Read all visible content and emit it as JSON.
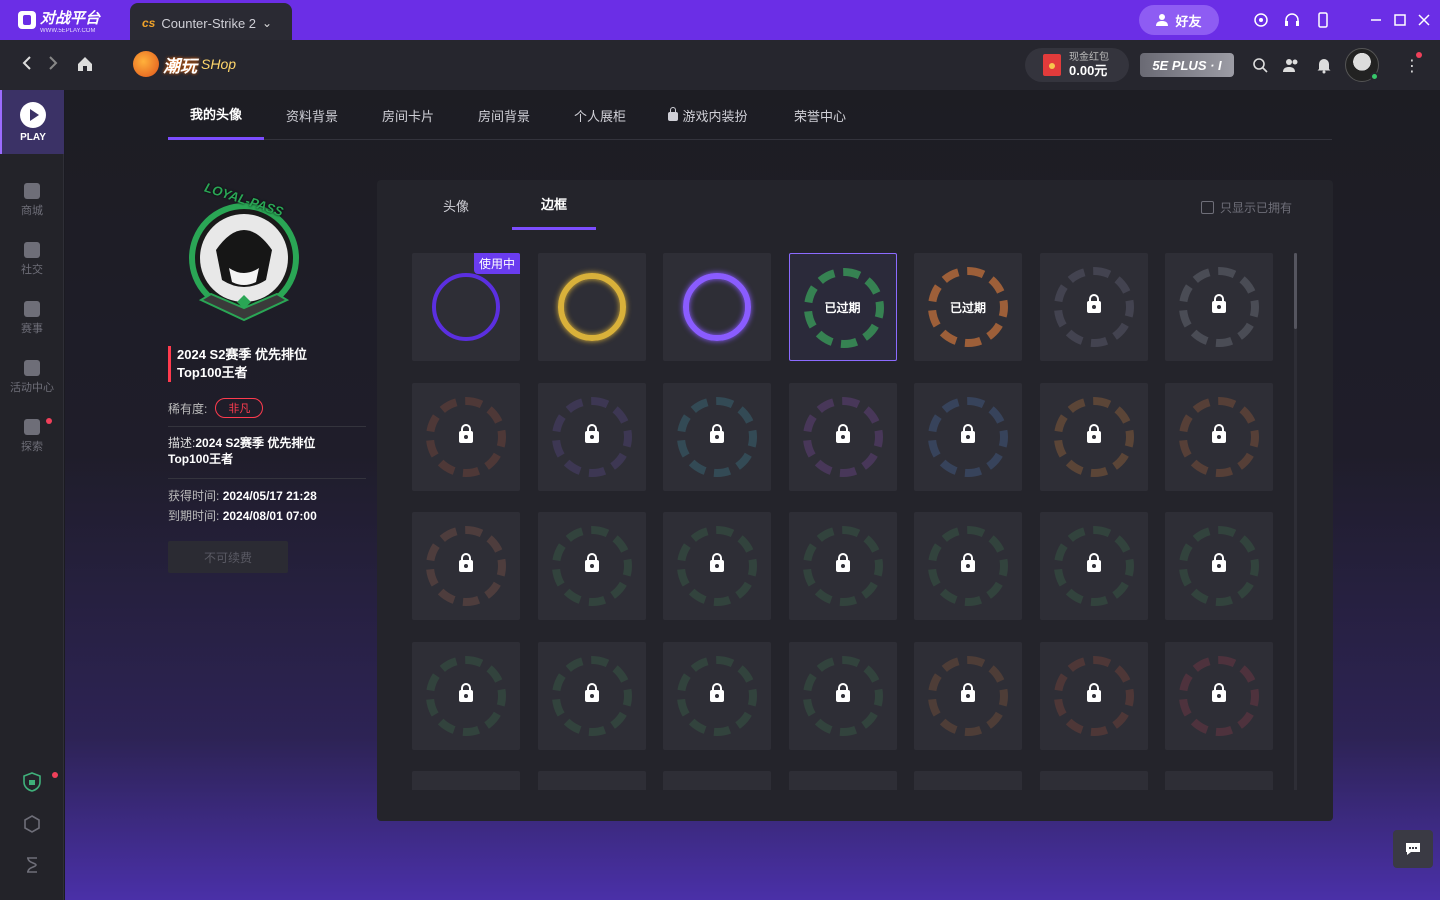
{
  "titlebar": {
    "app_name": "对战平台",
    "app_sub": "WWW.5EPLAY.COM",
    "game_tab": "Counter-Strike 2",
    "friends_label": "好友"
  },
  "navbar": {
    "shop_title": "潮玩",
    "shop_sub": "SHop",
    "wallet_label": "现金红包",
    "wallet_amount": "0.00元",
    "plus_label": "5E PLUS · I"
  },
  "sidebar": {
    "play_label": "PLAY",
    "items": [
      {
        "label": "商城",
        "icon": "bag-icon"
      },
      {
        "label": "社交",
        "icon": "chat-icon"
      },
      {
        "label": "赛事",
        "icon": "trophy-icon"
      },
      {
        "label": "活动中心",
        "icon": "gift-icon"
      },
      {
        "label": "探索",
        "icon": "grid-icon"
      }
    ]
  },
  "tabs": [
    {
      "label": "我的头像",
      "active": true
    },
    {
      "label": "资料背景",
      "active": false
    },
    {
      "label": "房间卡片",
      "active": false
    },
    {
      "label": "房间背景",
      "active": false
    },
    {
      "label": "个人展柜",
      "active": false
    },
    {
      "label": "游戏内装扮",
      "active": false,
      "locked": true
    },
    {
      "label": "荣誉中心",
      "active": false
    }
  ],
  "detail": {
    "title_line1": "2024 S2赛季 优先排位",
    "title_line2": "Top100王者",
    "rarity_label": "稀有度:",
    "rarity_value": "非凡",
    "desc_label": "描述:",
    "desc_line1": "2024 S2赛季 优先排位",
    "desc_line2": "Top100王者",
    "acquired_label": "获得时间:",
    "acquired_value": "2024/05/17 21:28",
    "expires_label": "到期时间:",
    "expires_value": "2024/08/01 07:00",
    "renew_label": "不可续费",
    "frame_text": "LOYAL-PASS"
  },
  "panel": {
    "subtabs": [
      {
        "label": "头像",
        "active": false
      },
      {
        "label": "边框",
        "active": true
      }
    ],
    "filter_label": "只显示已拥有",
    "in_use_label": "使用中",
    "expired_label": "已过期"
  },
  "colors": {
    "accent": "#6b2ee6",
    "active_underline": "#7c4dff",
    "rarity_red": "#ff3b4e"
  },
  "grid": [
    {
      "state": "in_use",
      "color": "#5b2fe0"
    },
    {
      "state": "owned",
      "color": "#d9b13a"
    },
    {
      "state": "owned",
      "color": "#8a5cff"
    },
    {
      "state": "expired",
      "color": "#3aa05a"
    },
    {
      "state": "expired",
      "color": "#c2703a"
    },
    {
      "state": "locked",
      "color": "#6c6c80"
    },
    {
      "state": "locked",
      "color": "#7f8590"
    },
    {
      "state": "locked",
      "color": "#8a4b3a"
    },
    {
      "state": "locked",
      "color": "#5a4a8a"
    },
    {
      "state": "locked",
      "color": "#3f7f90"
    },
    {
      "state": "locked",
      "color": "#7a4a9a"
    },
    {
      "state": "locked",
      "color": "#4a6aa0"
    },
    {
      "state": "locked",
      "color": "#b0703a"
    },
    {
      "state": "locked",
      "color": "#a0603a"
    },
    {
      "state": "locked",
      "color": "#8a5a4a"
    },
    {
      "state": "locked",
      "color": "#3a6a4a"
    },
    {
      "state": "locked",
      "color": "#3a6a4a"
    },
    {
      "state": "locked",
      "color": "#3a6a4a"
    },
    {
      "state": "locked",
      "color": "#3a6a4a"
    },
    {
      "state": "locked",
      "color": "#3a6a4a"
    },
    {
      "state": "locked",
      "color": "#3a6a4a"
    },
    {
      "state": "locked",
      "color": "#3a6a4a"
    },
    {
      "state": "locked",
      "color": "#3a6a4a"
    },
    {
      "state": "locked",
      "color": "#3a6a4a"
    },
    {
      "state": "locked",
      "color": "#3a6a4a"
    },
    {
      "state": "locked",
      "color": "#8a5a3a"
    },
    {
      "state": "locked",
      "color": "#8a4a3a"
    },
    {
      "state": "locked",
      "color": "#8a3a4a"
    }
  ]
}
